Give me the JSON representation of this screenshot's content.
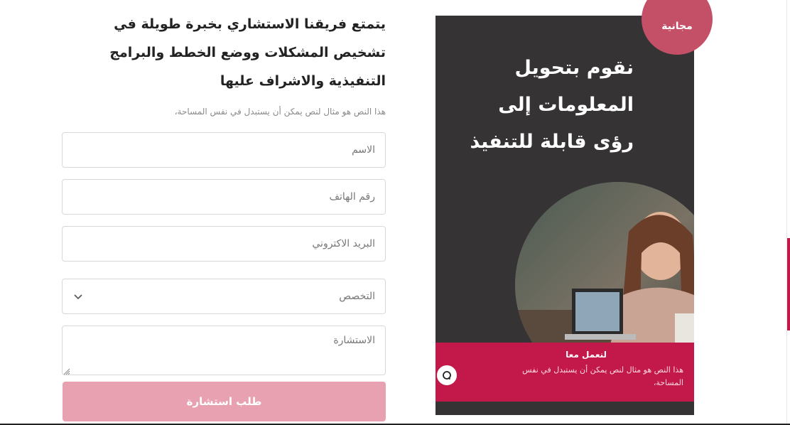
{
  "form": {
    "heading": "يتمتع فريقنا الاستشاري بخبرة طويلة في تشخيص المشكلات ووضع الخطط والبرامج التنفيذية والاشراف عليها",
    "subtitle": "هذا النص هو مثال لنص يمكن أن يستبدل في نفس المساحة،",
    "name_placeholder": "الاسم",
    "phone_placeholder": "رقم الهاتف",
    "email_placeholder": "البريد الاكتروني",
    "specialty_value": "التخصص",
    "consultation_placeholder": "الاستشارة",
    "submit_label": "طلب استشارة"
  },
  "card": {
    "badge": "مجانية",
    "title": "نقوم بتحويل المعلومات إلى رؤى قابلة للتنفيذ",
    "banner_title": "لنعمل معا",
    "banner_text": "هذا النص هو مثال لنص يمكن أن يستبدل في نفس المساحة،"
  },
  "colors": {
    "accent": "#c3194a",
    "badge": "#c45068",
    "submit": "#e8a1b0",
    "card_bg": "#353334"
  },
  "icons": [
    "chevron-down-icon",
    "chat-icon",
    "resize-handle-icon"
  ]
}
